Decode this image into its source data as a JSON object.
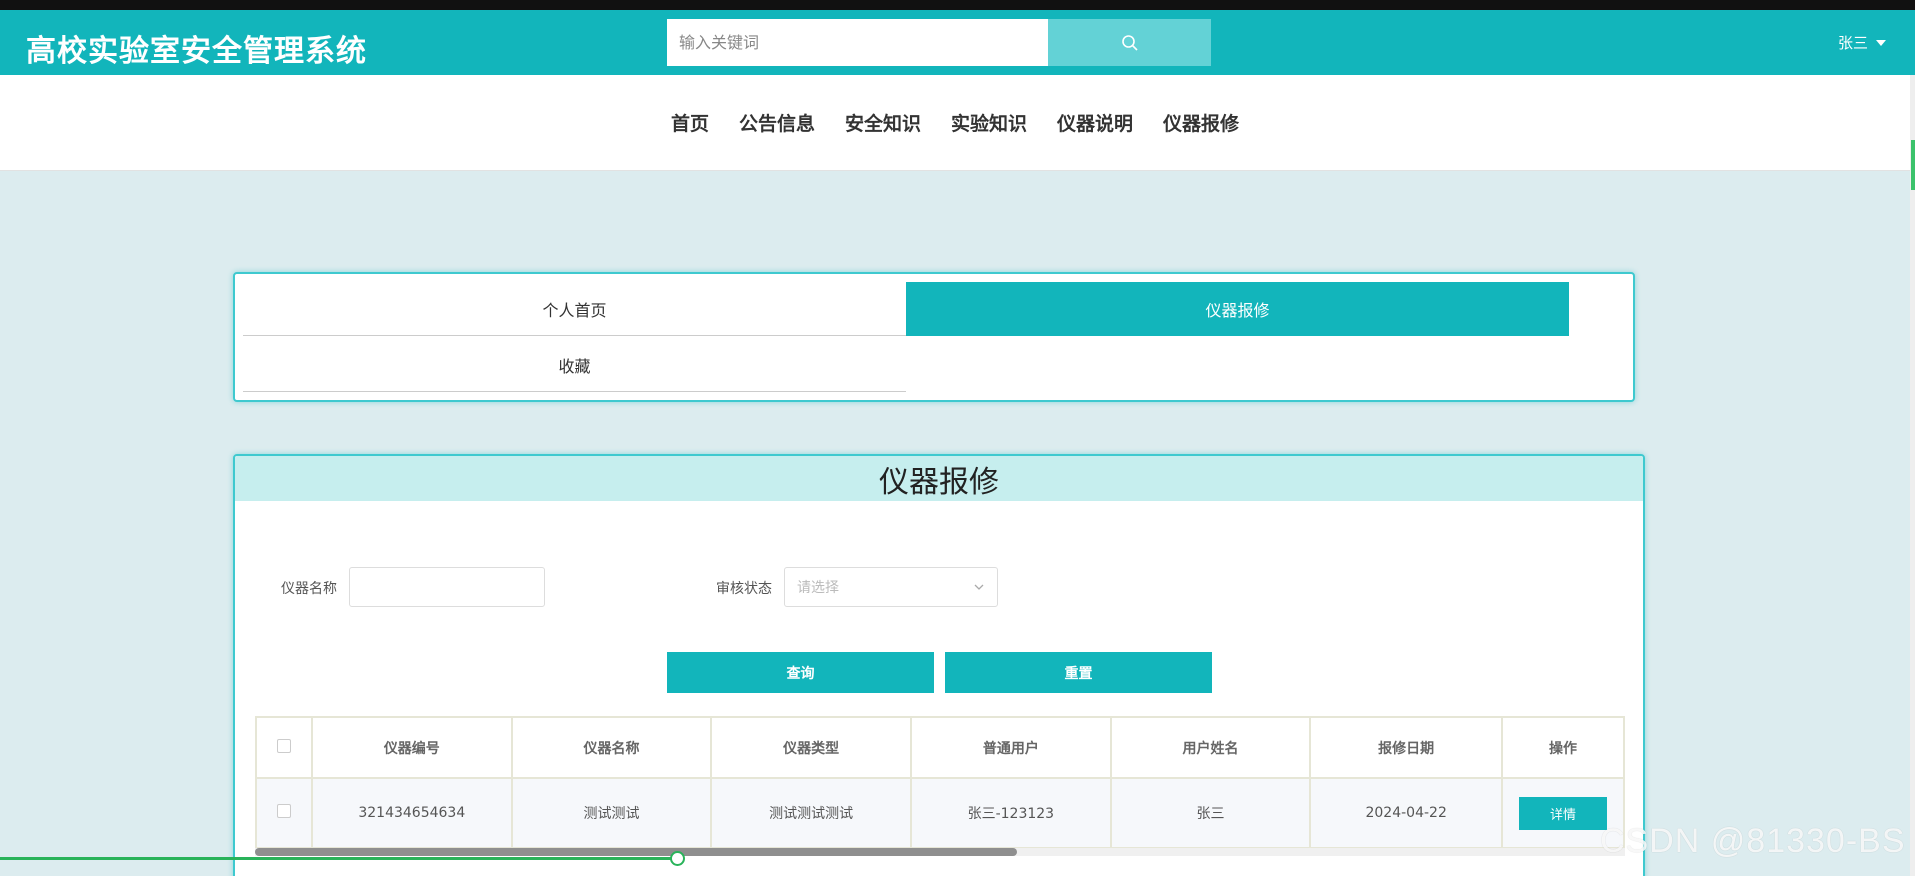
{
  "header": {
    "title": "高校实验室安全管理系统",
    "search": {
      "placeholder": "输入关键词",
      "icon": "search-icon"
    },
    "user": {
      "name": "张三",
      "icon": "caret-down-icon"
    }
  },
  "nav": {
    "items": [
      {
        "label": "首页"
      },
      {
        "label": "公告信息"
      },
      {
        "label": "安全知识"
      },
      {
        "label": "实验知识"
      },
      {
        "label": "仪器说明"
      },
      {
        "label": "仪器报修"
      }
    ]
  },
  "tabs": [
    {
      "label": "个人首页",
      "active": false
    },
    {
      "label": "仪器报修",
      "active": true
    },
    {
      "label": "收藏",
      "active": false
    }
  ],
  "panel": {
    "title": "仪器报修",
    "filters": {
      "name_label": "仪器名称",
      "name_value": "",
      "status_label": "审核状态",
      "status_placeholder": "请选择"
    },
    "buttons": {
      "query": "查询",
      "reset": "重置"
    },
    "table": {
      "columns": [
        "仪器编号",
        "仪器名称",
        "仪器类型",
        "普通用户",
        "用户姓名",
        "报修日期",
        "操作"
      ],
      "rows": [
        {
          "id": "321434654634",
          "name": "测试测试",
          "type": "测试测试测试",
          "user": "张三-123123",
          "realname": "张三",
          "date": "2024-04-22",
          "action": "详情"
        }
      ]
    }
  },
  "watermark": "CSDN @81330-BS",
  "colors": {
    "accent": "#12b5bb",
    "panel_header": "#c6eeee",
    "background": "#dcecef"
  }
}
